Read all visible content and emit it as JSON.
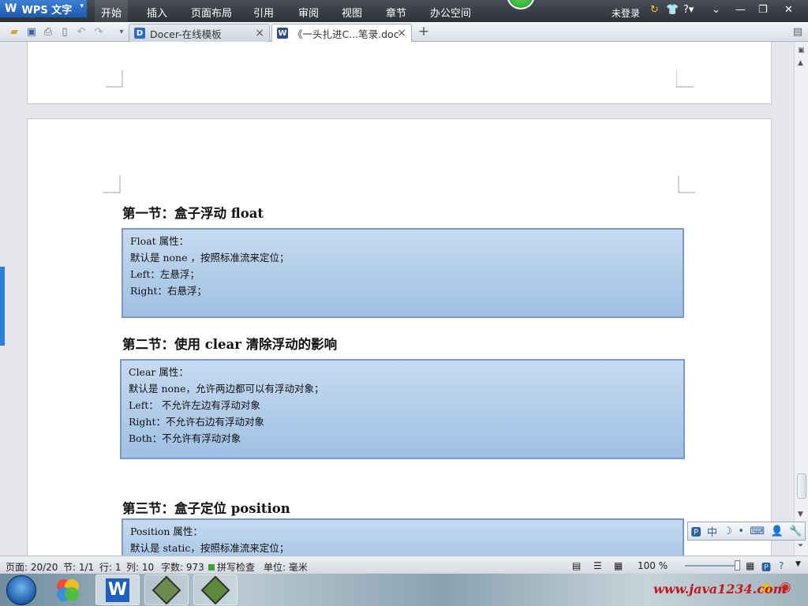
{
  "menubar": {
    "app_label": "WPS 文字",
    "items": [
      "开始",
      "插入",
      "页面布局",
      "引用",
      "审阅",
      "视图",
      "章节",
      "办公空间"
    ],
    "login": "未登录",
    "help": "?"
  },
  "tabs": [
    {
      "label": "Docer-在线模板"
    },
    {
      "label": "《一头扎进C...笔录.doc"
    }
  ],
  "document": {
    "section1": {
      "heading": "第一节：盒子浮动 float",
      "lines": [
        "Float 属性：",
        "默认是 none ，按照标准流来定位；",
        "Left：左悬浮；",
        "Right：右悬浮；"
      ]
    },
    "section2": {
      "heading": "第二节：使用 clear 清除浮动的影响",
      "lines": [
        "Clear 属性：",
        "默认是 none，允许两边都可以有浮动对象；",
        "Left：  不允许左边有浮动对象",
        "Right：不允许右边有浮动对象",
        "Both：不允许有浮动对象"
      ]
    },
    "section3": {
      "heading": "第三节：盒子定位 position",
      "lines": [
        "Position 属性：",
        "默认是 static，按照标准流来定位；"
      ]
    }
  },
  "ime": {
    "mode": "中"
  },
  "statusbar": {
    "page": "页面: 20/20",
    "section": "节: 1/1",
    "row": "行: 1",
    "col": "列: 10",
    "words": "字数: 973",
    "spell": "拼写检查",
    "unit": "单位: 毫米",
    "zoom": "100 %"
  },
  "watermark": "www.java1234.com",
  "colors": {
    "accent": "#1c5bb0",
    "box_fill": "#b3cde9",
    "box_border": "#7a9ac2"
  }
}
